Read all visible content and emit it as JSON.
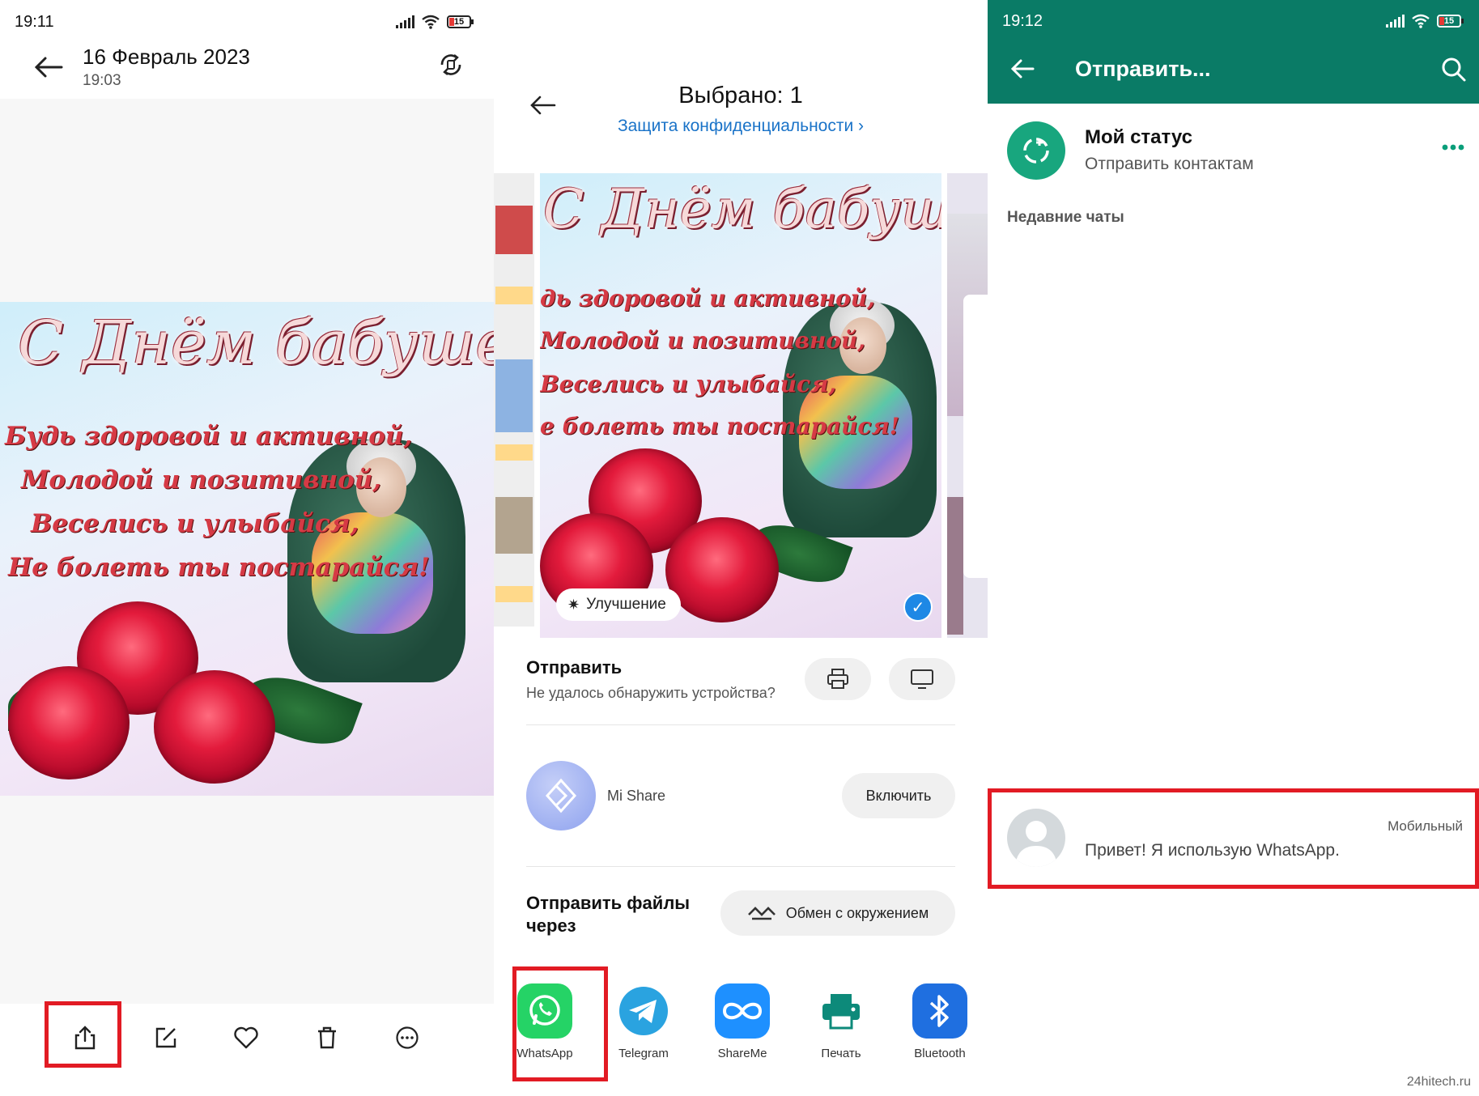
{
  "panel_gallery": {
    "status_time": "19:11",
    "battery": "15",
    "date_title": "16 Февраль 2023",
    "time_subtitle": "19:03",
    "image_text": {
      "headline": "С Днём бабушек!",
      "line1": "Будь здоровой и активной,",
      "line2": "Молодой и позитивной,",
      "line3": "Веселись и улыбайся,",
      "line4": "Не болеть ты постарайся!"
    },
    "toolbar_icons": [
      "share-icon",
      "edit-icon",
      "heart-icon",
      "trash-icon",
      "more-icon"
    ]
  },
  "panel_share": {
    "title": "Выбрано: 1",
    "privacy_link": "Защита конфиденциальности",
    "privacy_chevron": "›",
    "enhance_label": "Улучшение",
    "image_text": {
      "headline": "С Днём бабушек",
      "line1": "дь здоровой и активной,",
      "line2": "Молодой и позитивной,",
      "line3": "Веселись и улыбайся,",
      "line4": "е болеть ты постарайся!"
    },
    "send_title": "Отправить",
    "send_subtitle": "Не удалось обнаружить устройства?",
    "mishare_label": "Mi Share",
    "enable_label": "Включить",
    "send_files_title": "Отправить файлы через",
    "nearby_label": "Обмен с окружением",
    "apps": [
      {
        "label": "WhatsApp",
        "color": "#25d366"
      },
      {
        "label": "Telegram",
        "color": "#2aa3e0"
      },
      {
        "label": "ShareMe",
        "color": "#1e90ff"
      },
      {
        "label": "Печать",
        "color": "#0d8a7a"
      },
      {
        "label": "Bluetooth",
        "color": "#1f6fe0"
      }
    ]
  },
  "panel_whatsapp": {
    "status_time": "19:12",
    "battery": "15",
    "title": "Отправить...",
    "my_status_title": "Мой статус",
    "my_status_sub": "Отправить контактам",
    "recent_chats": "Недавние чаты",
    "contact_type": "Мобильный",
    "contact_about": "Привет! Я использую WhatsApp.",
    "accent": "#0a7b66"
  },
  "watermark": "24hitech.ru"
}
